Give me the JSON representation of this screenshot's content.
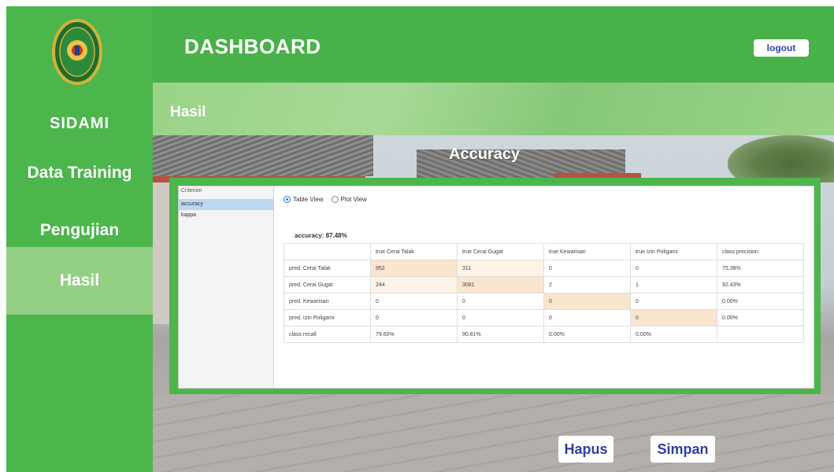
{
  "sidebar": {
    "brand": "SIDAMI",
    "items": [
      {
        "label": "Data Training"
      },
      {
        "label": "Pengujian"
      },
      {
        "label": "Hasil"
      }
    ]
  },
  "header": {
    "title": "DASHBOARD",
    "logout_label": "logout",
    "subtitle": "Hasil"
  },
  "main": {
    "section_title": "Accuracy",
    "criteria": {
      "header": "Criterion",
      "items": [
        "accuracy",
        "kappa"
      ],
      "selected": "accuracy"
    },
    "view_options": {
      "table_view": "Table View",
      "plot_view": "Plot View",
      "selected": "Table View"
    },
    "accuracy_text": "accuracy: 87.48%",
    "table": {
      "header": [
        "",
        "true Cerai Talak",
        "true Cerai Gugat",
        "true Kewarisan",
        "true Izin Poligami",
        "class precision"
      ],
      "rows": [
        [
          "pred. Cerai Talak",
          "952",
          "311",
          "0",
          "0",
          "75.38%"
        ],
        [
          "pred. Cerai Gugat",
          "244",
          "3081",
          "2",
          "1",
          "92.43%"
        ],
        [
          "pred. Kewarisan",
          "0",
          "0",
          "0",
          "0",
          "0.00%"
        ],
        [
          "pred. Izin Poligami",
          "0",
          "0",
          "0",
          "0",
          "0.00%"
        ],
        [
          "class recall",
          "79.60%",
          "90.81%",
          "0.00%",
          "0.00%",
          ""
        ]
      ]
    }
  },
  "actions": {
    "hapus_label": "Hapus",
    "simpan_label": "Simpan"
  },
  "colors": {
    "sidebar_green": "#4cb54c",
    "header_green": "#49b149",
    "active_nav": "#94cf86",
    "button_text": "#2f3fa0",
    "diagonal_highlight": "#fae5cf"
  }
}
